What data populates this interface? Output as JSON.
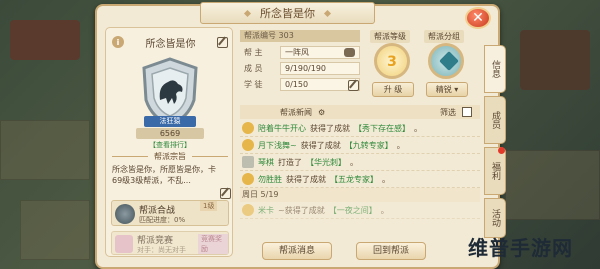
{
  "panel": {
    "title": "所念皆是你",
    "close_label": "✕"
  },
  "left_card": {
    "guild_name": "所念皆是你",
    "badge_name": "法狂猿",
    "score": "6569",
    "rank_link": "【查看排行】",
    "motto_title": "帮派宗旨",
    "motto_text": "所念皆是你，所愿皆是你，卡69级3级帮派，不乱...",
    "battle": {
      "name": "帮派合战",
      "progress": "匹配进度：0%",
      "tag": "1级"
    },
    "contest": {
      "name": "帮派竞赛",
      "sub": "对手：尚无对手",
      "tag": "竞赛奖励"
    }
  },
  "guild_info": {
    "id_label": "帮派编号 303",
    "leader_label": "帮 主",
    "leader_value": "一阵风",
    "members_label": "成 员",
    "members_value": "9/190/190",
    "study_label": "学 徒",
    "study_value": "0/150"
  },
  "level_section": {
    "level_title": "帮派等级",
    "level_value": "3",
    "group_title": "帮派分组",
    "upgrade_btn": "升 级",
    "elite_btn": "精锐"
  },
  "news": {
    "header": "帮派新闻",
    "filter": "筛选",
    "items": [
      {
        "who": "陪着牛牛开心",
        "action": "获得了成就",
        "hl": "【秀下存在感】",
        "end": "。",
        "icon": "star"
      },
      {
        "who": "月下浅舞~",
        "action": "获得了成就",
        "hl": "【九转专家】",
        "end": "。",
        "icon": "star"
      },
      {
        "who": "琴棋",
        "action": "打造了",
        "hl": "【华光刺】",
        "end": "。",
        "icon": "stone"
      },
      {
        "who": "勿胜胜",
        "action": "获得了成就",
        "hl": "【五龙专家】",
        "end": "。",
        "icon": "star"
      }
    ],
    "date": "周日 5/19",
    "last": {
      "who": "米卡",
      "action": "~获得了成就",
      "hl": "【一夜之间】",
      "end": "。"
    }
  },
  "bottom": {
    "msg_btn": "帮派消息",
    "return_btn": "回到帮派"
  },
  "tabs": [
    "信息",
    "成员",
    "福利",
    "活动"
  ],
  "watermark": "维普手游网"
}
